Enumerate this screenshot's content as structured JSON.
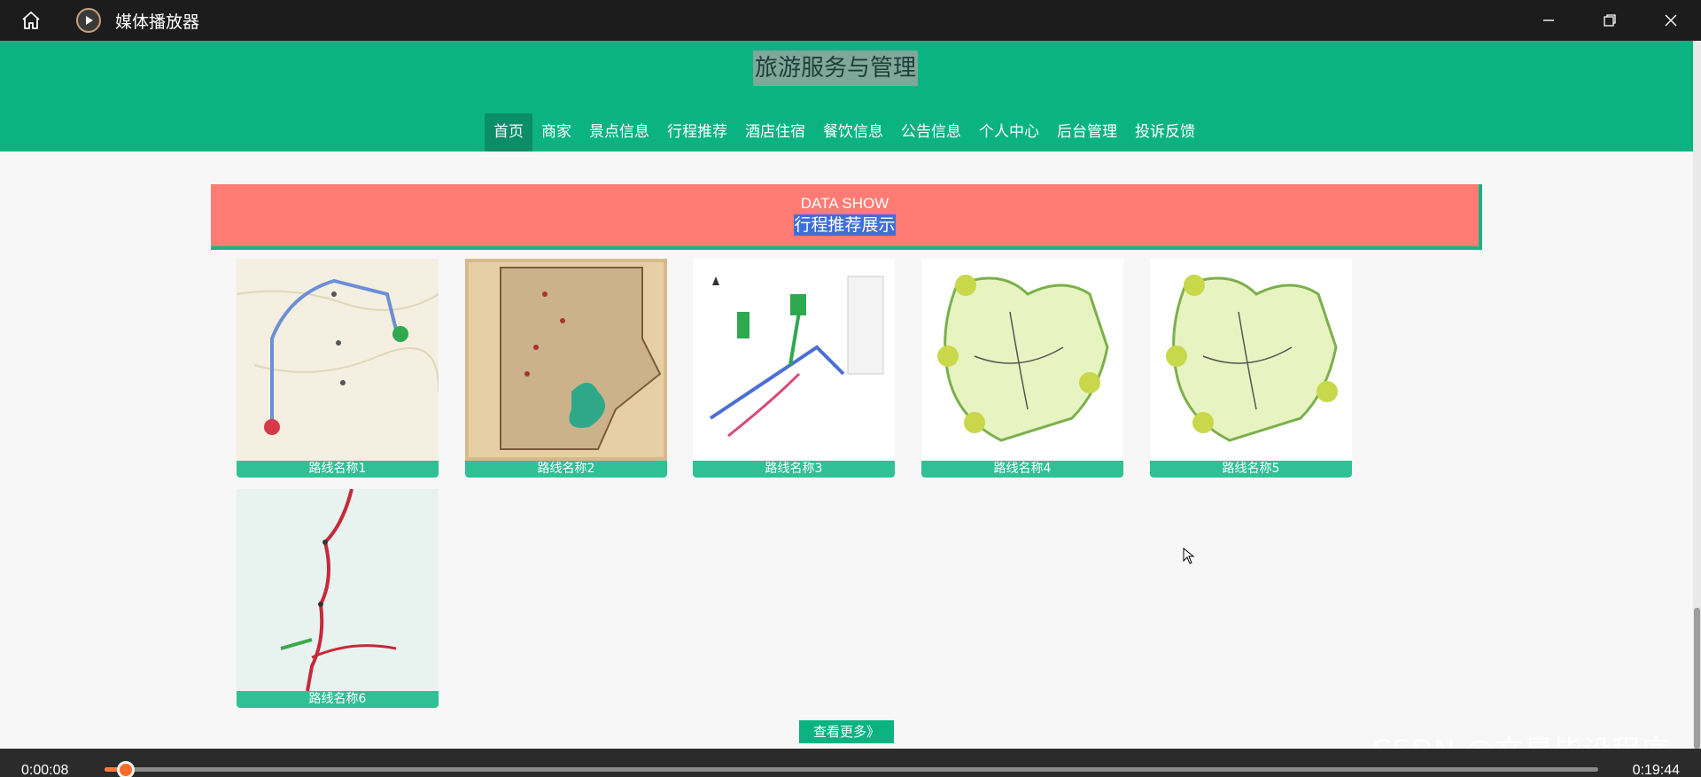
{
  "player": {
    "app_title": "媒体播放器",
    "icons": [
      "home-icon",
      "media-player-icon",
      "minimize-icon",
      "restore-icon",
      "close-icon"
    ],
    "current_time": "0:00:08",
    "total_time": "0:19:44",
    "progress_fraction": 0.007
  },
  "site": {
    "title": "旅游服务与管理",
    "nav": [
      {
        "label": "首页",
        "active": true
      },
      {
        "label": "商家",
        "active": false
      },
      {
        "label": "景点信息",
        "active": false
      },
      {
        "label": "行程推荐",
        "active": false
      },
      {
        "label": "酒店住宿",
        "active": false
      },
      {
        "label": "餐饮信息",
        "active": false
      },
      {
        "label": "公告信息",
        "active": false
      },
      {
        "label": "个人中心",
        "active": false
      },
      {
        "label": "后台管理",
        "active": false
      },
      {
        "label": "投诉反馈",
        "active": false
      }
    ]
  },
  "section": {
    "title_en": "DATA SHOW",
    "title_cn": "行程推荐展示"
  },
  "routes": [
    {
      "label": "路线名称1"
    },
    {
      "label": "路线名称2"
    },
    {
      "label": "路线名称3"
    },
    {
      "label": "路线名称4"
    },
    {
      "label": "路线名称5"
    },
    {
      "label": "路线名称6"
    }
  ],
  "more_button": "查看更多》",
  "watermark": "CSDN @文星毕设程序",
  "colors": {
    "header_green": "#0bb382",
    "banner_red": "#ff7b73",
    "label_green": "#2fc195",
    "progress_orange": "#ff7a3a"
  }
}
